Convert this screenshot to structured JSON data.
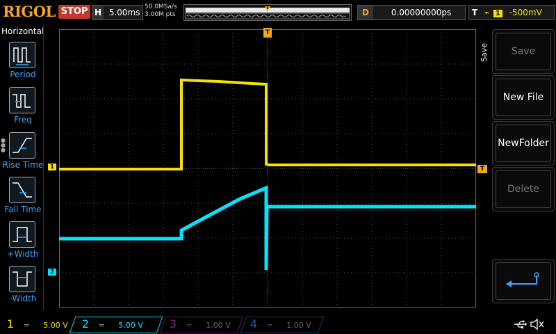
{
  "header": {
    "brand": "RIGOL",
    "run_state": "STOP",
    "timebase_label": "H",
    "timebase_value": "5.00ms",
    "sample_rate": "50.0MSa/s",
    "mem_depth": "3.00M pts",
    "trigger_marker": "T",
    "delay_label": "D",
    "delay_value": "0.00000000ps",
    "trigger_label": "T",
    "trigger_source": "1",
    "trigger_level": "-500mV"
  },
  "left_panel": {
    "title": "Horizontal",
    "items": [
      {
        "label": "Period"
      },
      {
        "label": "Freq"
      },
      {
        "label": "Rise Time"
      },
      {
        "label": "Fall Time"
      },
      {
        "label": "+Width"
      },
      {
        "label": "-Width"
      }
    ]
  },
  "right_panel": {
    "side_label": "Save",
    "buttons": [
      {
        "label": "Save",
        "enabled": false
      },
      {
        "label": "New File",
        "enabled": true
      },
      {
        "label": "NewFolder",
        "enabled": true
      },
      {
        "label": "Delete",
        "enabled": false
      }
    ]
  },
  "markers": {
    "ch1": "1",
    "ch2": "2",
    "trigger_top": "T",
    "trigger_right": "T"
  },
  "channels": [
    {
      "num": "1",
      "coupling": "=",
      "scale": "5.00 V",
      "color": "#f5e200",
      "active": true
    },
    {
      "num": "2",
      "coupling": "=",
      "scale": "5.00 V",
      "color": "#00e5ff",
      "active": true
    },
    {
      "num": "3",
      "coupling": "=",
      "scale": "1.00 V",
      "color": "#c02fc0",
      "active": false
    },
    {
      "num": "4",
      "coupling": "=",
      "scale": "1.00 V",
      "color": "#2f6fd0",
      "active": false
    }
  ],
  "colors": {
    "ch1": "#f5e200",
    "ch2": "#00e5ff",
    "accent": "#f5a623",
    "stop": "#c0392b",
    "menu_label": "#37a7ff"
  },
  "status_icons": [
    "usb-icon",
    "speaker-icon"
  ]
}
